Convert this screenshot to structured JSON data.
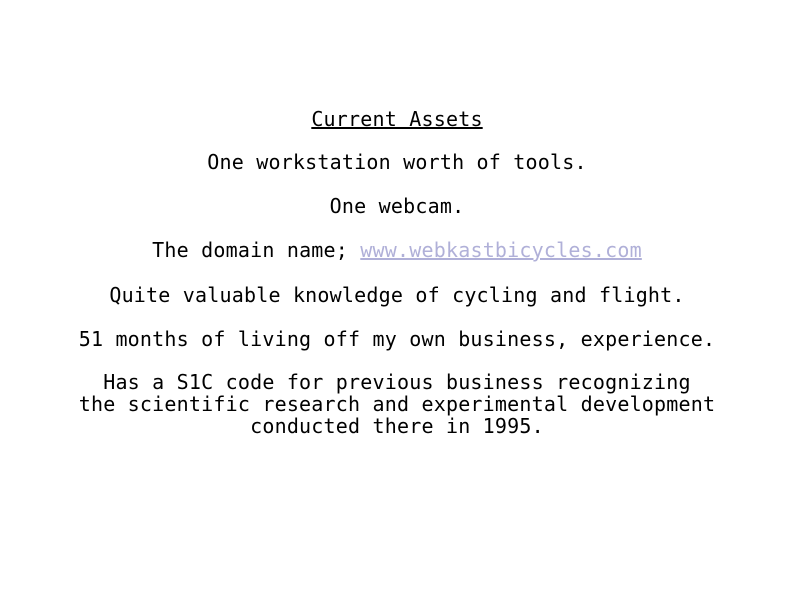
{
  "slide": {
    "title": "Current Assets",
    "items": [
      "One workstation worth of tools.",
      "One webcam.",
      {
        "prefix": "The domain name; ",
        "link_text": "www.webkastbicycles.com"
      },
      "Quite valuable knowledge of cycling and flight.",
      "51 months of living off my own business, experience."
    ],
    "paragraph_lines": [
      "Has a S1C code for previous business recognizing",
      "the scientific research and experimental development",
      "conducted there in 1995."
    ]
  },
  "colors": {
    "text": "#000000",
    "link": "#b0b0d8",
    "background": "#ffffff"
  }
}
